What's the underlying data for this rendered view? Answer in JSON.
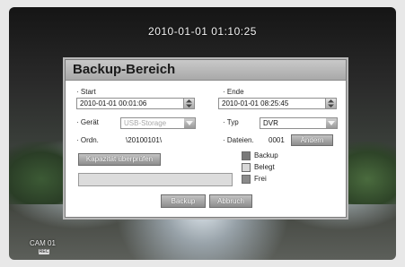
{
  "screen": {
    "datetime": "2010-01-01 01:10:25",
    "camera": {
      "label": "CAM 01",
      "badge": "REC"
    }
  },
  "dialog": {
    "title": "Backup-Bereich",
    "start": {
      "label": "· Start",
      "value": "2010-01-01 00:01:06"
    },
    "end": {
      "label": "· Ende",
      "value": "2010-01-01 08:25:45"
    },
    "device": {
      "label": "· Gerät",
      "value": "USB-Storage",
      "disabled": true
    },
    "type": {
      "label": "· Typ",
      "value": "DVR"
    },
    "folder": {
      "label": "· Ordn.",
      "value": "\\20100101\\"
    },
    "files": {
      "label": "· Dateien.",
      "value": "0001",
      "change_label": "Ändern"
    },
    "check_capacity_label": "Kapazität überprüfen",
    "capacity_progress": 0,
    "legend": [
      {
        "label": "Backup",
        "color": "#7a7a7a"
      },
      {
        "label": "Belegt",
        "color": "#d8d8d8"
      },
      {
        "label": "Frei",
        "color": "#8a8a8a"
      }
    ],
    "buttons": {
      "backup": "Backup",
      "cancel": "Abbruch"
    }
  }
}
